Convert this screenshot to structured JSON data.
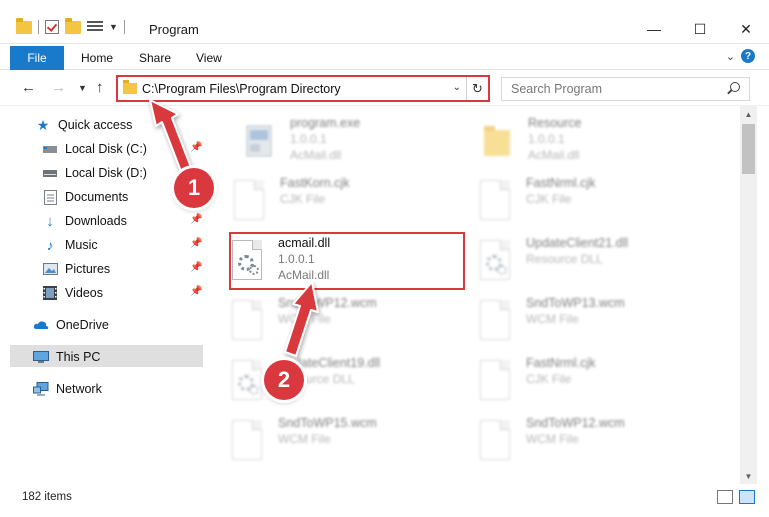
{
  "window": {
    "title": "Program",
    "minimize_glyph": "—",
    "maximize_glyph": "☐",
    "close_glyph": "✕"
  },
  "ribbon": {
    "file_label": "File",
    "home_label": "Home",
    "share_label": "Share",
    "view_label": "View",
    "help_glyph": "?"
  },
  "address": {
    "path": "C:\\Program Files\\Program Directory",
    "search_placeholder": "Search Program"
  },
  "sidebar": {
    "items": [
      {
        "label": "Quick access",
        "icon": "star-icon"
      },
      {
        "label": "Local Disk (C:)",
        "icon": "drive-icon"
      },
      {
        "label": "Local Disk (D:)",
        "icon": "drive-icon"
      },
      {
        "label": "Documents",
        "icon": "documents-icon"
      },
      {
        "label": "Downloads",
        "icon": "download-icon"
      },
      {
        "label": "Music",
        "icon": "music-icon"
      },
      {
        "label": "Pictures",
        "icon": "pictures-icon"
      },
      {
        "label": "Videos",
        "icon": "videos-icon"
      },
      {
        "label": "OneDrive",
        "icon": "cloud-icon"
      },
      {
        "label": "This PC",
        "icon": "computer-icon"
      },
      {
        "label": "Network",
        "icon": "network-icon"
      }
    ]
  },
  "files": [
    {
      "name": "program.exe",
      "line2": "1.0.0.1",
      "line3": "AcMail.dll"
    },
    {
      "name": "Resource",
      "line2": "1.0.0.1",
      "line3": "AcMail.dll"
    },
    {
      "name": "FastKorn.cjk",
      "line2": "CJK File",
      "line3": ""
    },
    {
      "name": "FastNrml.cjk",
      "line2": "CJK File",
      "line3": ""
    },
    {
      "name": "acmail.dll",
      "line2": "1.0.0.1",
      "line3": "AcMail.dll"
    },
    {
      "name": "UpdateClient21.dll",
      "line2": "Resource DLL",
      "line3": ""
    },
    {
      "name": "SndToWP12.wcm",
      "line2": "WCM File",
      "line3": ""
    },
    {
      "name": "SndToWP13.wcm",
      "line2": "WCM File",
      "line3": ""
    },
    {
      "name": "UpdateClient19.dll",
      "line2": "Resource DLL",
      "line3": ""
    },
    {
      "name": "FastNrml.cjk",
      "line2": "CJK File",
      "line3": ""
    },
    {
      "name": "SndToWP15.wcm",
      "line2": "WCM File",
      "line3": ""
    },
    {
      "name": "SndToWP12.wcm",
      "line2": "WCM File",
      "line3": ""
    }
  ],
  "status": {
    "item_count": "182 items"
  },
  "annotations": {
    "step1": "1",
    "step2": "2",
    "color": "#d9383e"
  }
}
